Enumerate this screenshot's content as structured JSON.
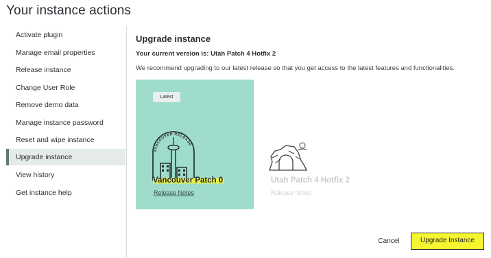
{
  "page": {
    "title": "Your instance actions"
  },
  "sidebar": {
    "items": [
      {
        "label": "Activate plugin"
      },
      {
        "label": "Manage email properties"
      },
      {
        "label": "Release instance"
      },
      {
        "label": "Change User Role"
      },
      {
        "label": "Remove demo data"
      },
      {
        "label": "Manage instance password"
      },
      {
        "label": "Reset and wipe instance"
      },
      {
        "label": "Upgrade instance",
        "active": true
      },
      {
        "label": "View history"
      },
      {
        "label": "Get instance help"
      }
    ]
  },
  "main": {
    "title": "Upgrade instance",
    "current_version": "Your current version is: Utah Patch 4 Hotfix 2",
    "recommendation": "We recommend upgrading to our latest release so that you get access to the latest features and functionalities.",
    "cards": [
      {
        "badge": "Latest",
        "illustration_text": "VANCOUVER RELEASE",
        "title": "Vancouver Patch 0",
        "link": "Release Notes",
        "selected": true,
        "icon": "vancouver-tower-icon"
      },
      {
        "title": "Utah Patch 4 Hotfix 2",
        "link": "Release Notes",
        "selected": false,
        "icon": "utah-arch-icon"
      }
    ],
    "actions": {
      "cancel": "Cancel",
      "upgrade": "Upgrade Instance"
    }
  },
  "colors": {
    "card_selected_bg": "#9fdccc",
    "highlight": "#e8f34a",
    "sidebar_active_bg": "#e4ebe9"
  }
}
